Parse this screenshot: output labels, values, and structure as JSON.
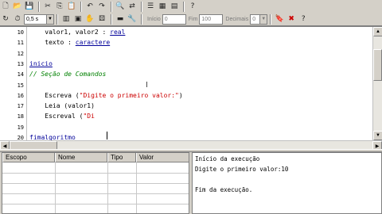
{
  "toolbar1": {
    "icons": [
      "new-file",
      "open-folder",
      "save",
      "blank",
      "cut",
      "copy",
      "paste",
      "blank",
      "undo",
      "redo",
      "blank",
      "find",
      "blank",
      "list",
      "grid",
      "blank",
      "help"
    ]
  },
  "toolbar2": {
    "speed_value": "0,5 s",
    "inicio_label": "Início",
    "inicio_value": "0",
    "fim_label": "Fim",
    "fim_value": "100",
    "decimais_label": "Decimais",
    "decimais_value": "0"
  },
  "editor": {
    "lines": [
      {
        "num": "10",
        "parts": [
          {
            "t": "    valor1, valor2 : ",
            "s": ""
          },
          {
            "t": "real",
            "s": "kw"
          }
        ]
      },
      {
        "num": "11",
        "parts": [
          {
            "t": "    texto : ",
            "s": ""
          },
          {
            "t": "caractere",
            "s": "kw"
          }
        ]
      },
      {
        "num": "12",
        "parts": []
      },
      {
        "num": "13",
        "parts": [
          {
            "t": "inicio",
            "s": "kw"
          }
        ]
      },
      {
        "num": "14",
        "parts": [
          {
            "t": "// Seção de Comandos",
            "s": "cmt"
          }
        ]
      },
      {
        "num": "15",
        "parts": []
      },
      {
        "num": "16",
        "parts": [
          {
            "t": "    Escreva (",
            "s": ""
          },
          {
            "t": "\"Digite o primeiro valor:\"",
            "s": "str"
          },
          {
            "t": ")",
            "s": ""
          }
        ]
      },
      {
        "num": "17",
        "parts": [
          {
            "t": "    Leia (valor1)",
            "s": ""
          }
        ]
      },
      {
        "num": "18",
        "parts": [
          {
            "t": "    Escreval (",
            "s": ""
          },
          {
            "t": "\"Di",
            "s": "str"
          }
        ]
      },
      {
        "num": "19",
        "parts": []
      },
      {
        "num": "20",
        "parts": [
          {
            "t": "fimalgoritmo",
            "s": "kw"
          }
        ]
      }
    ]
  },
  "variables": {
    "columns": [
      "Escopo",
      "Nome",
      "Tipo",
      "Valor"
    ],
    "rows": []
  },
  "output": {
    "lines": [
      "Início da execução",
      "Digite o primeiro valor:10",
      "",
      "Fim da execução."
    ]
  },
  "colors": {
    "keyword": "#000099",
    "string": "#cc0000",
    "comment": "#008000"
  }
}
